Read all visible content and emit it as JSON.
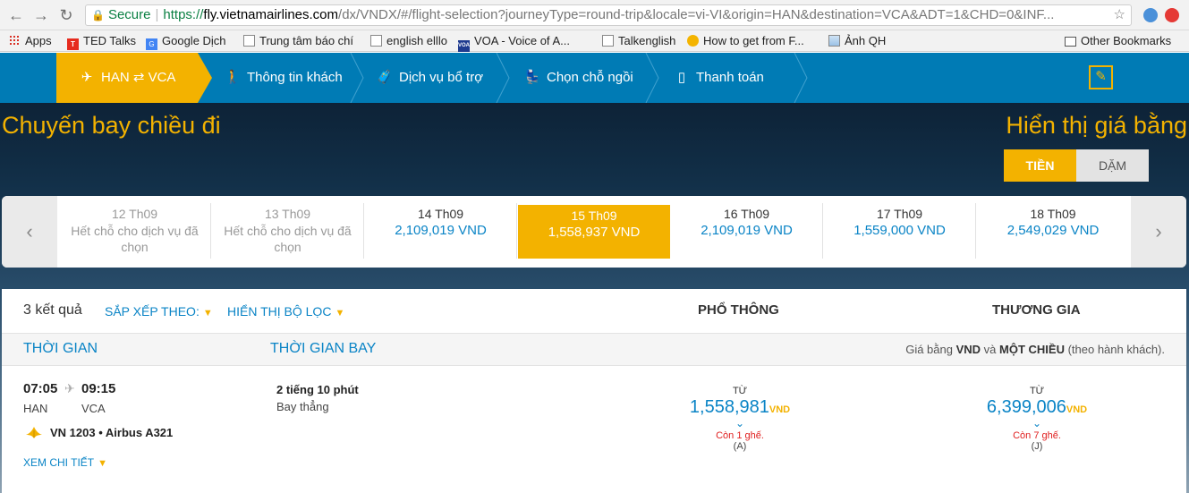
{
  "browser": {
    "secure_label": "Secure",
    "url_scheme": "https://",
    "url_host": "fly.vietnamairlines.com",
    "url_path": "/dx/VNDX/#/flight-selection?journeyType=round-trip&locale=vi-VI&origin=HAN&destination=VCA&ADT=1&CHD=0&INF..."
  },
  "bookmarks": {
    "apps": "Apps",
    "ted": "TED Talks",
    "google_translate": "Google Dịch",
    "press": "Trung tâm báo chí",
    "elllo": "english elllo",
    "voa": "VOA - Voice of A...",
    "talkenglish": "Talkenglish",
    "howto": "How to get from F...",
    "qh": "Ảnh QH",
    "other": "Other Bookmarks"
  },
  "steps": {
    "route": "HAN ⇄ VCA",
    "passengers": "Thông tin khách",
    "services": "Dịch vụ bổ trợ",
    "seats": "Chọn chỗ ngồi",
    "payment": "Thanh toán"
  },
  "header": {
    "section_title": "Chuyến bay chiều đi",
    "display_title": "Hiển thị giá bằng",
    "money": "TIỀN",
    "miles": "DẶM"
  },
  "dates": [
    {
      "date": "12 Th09",
      "status": "Hết chỗ cho dịch vụ đã chọn"
    },
    {
      "date": "13 Th09",
      "status": "Hết chỗ cho dịch vụ đã chọn"
    },
    {
      "date": "14 Th09",
      "price": "2,109,019 VND"
    },
    {
      "date": "15 Th09",
      "price": "1,558,937 VND"
    },
    {
      "date": "16 Th09",
      "price": "2,109,019 VND"
    },
    {
      "date": "17 Th09",
      "price": "1,559,000 VND"
    },
    {
      "date": "18 Th09",
      "price": "2,549,029 VND"
    }
  ],
  "results": {
    "count": "3 kết quả",
    "sort": "SẮP XẾP THEO:",
    "filter": "HIỂN THỊ BỘ LỌC",
    "economy": "PHỔ THÔNG",
    "business": "THƯƠNG GIA",
    "col_time": "THỜI GIAN",
    "col_duration": "THỜI GIAN BAY",
    "note_prefix": "Giá bằng ",
    "note_currency": "VND",
    "note_mid": " và ",
    "note_oneway": "MỘT CHIỀU",
    "note_suffix": " (theo hành khách)."
  },
  "flight": {
    "dep_time": "07:05",
    "arr_time": "09:15",
    "dep_airport": "HAN",
    "arr_airport": "VCA",
    "flight_number": "VN 1203",
    "aircraft": "Airbus A321",
    "details": "XEM CHI TIẾT",
    "duration": "2 tiếng 10 phút",
    "stops": "Bay thẳng",
    "economy": {
      "from": "TỪ",
      "amount": "1,558,981",
      "currency": "VND",
      "seats": "Còn 1 ghế.",
      "class": "(A)"
    },
    "business": {
      "from": "TỪ",
      "amount": "6,399,006",
      "currency": "VND",
      "seats": "Còn 7 ghế.",
      "class": "(J)"
    }
  }
}
